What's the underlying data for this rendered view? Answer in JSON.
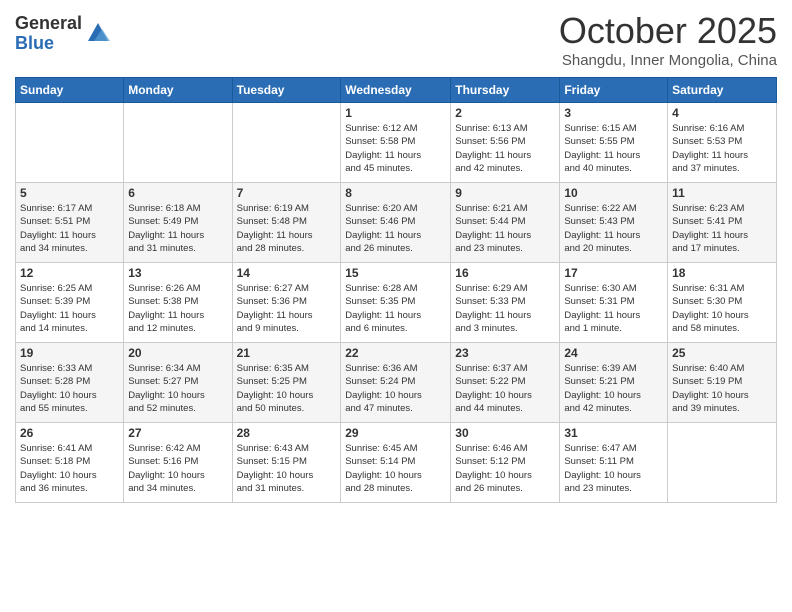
{
  "logo": {
    "general": "General",
    "blue": "Blue"
  },
  "header": {
    "month": "October 2025",
    "location": "Shangdu, Inner Mongolia, China"
  },
  "weekdays": [
    "Sunday",
    "Monday",
    "Tuesday",
    "Wednesday",
    "Thursday",
    "Friday",
    "Saturday"
  ],
  "weeks": [
    [
      {
        "day": "",
        "info": ""
      },
      {
        "day": "",
        "info": ""
      },
      {
        "day": "",
        "info": ""
      },
      {
        "day": "1",
        "info": "Sunrise: 6:12 AM\nSunset: 5:58 PM\nDaylight: 11 hours\nand 45 minutes."
      },
      {
        "day": "2",
        "info": "Sunrise: 6:13 AM\nSunset: 5:56 PM\nDaylight: 11 hours\nand 42 minutes."
      },
      {
        "day": "3",
        "info": "Sunrise: 6:15 AM\nSunset: 5:55 PM\nDaylight: 11 hours\nand 40 minutes."
      },
      {
        "day": "4",
        "info": "Sunrise: 6:16 AM\nSunset: 5:53 PM\nDaylight: 11 hours\nand 37 minutes."
      }
    ],
    [
      {
        "day": "5",
        "info": "Sunrise: 6:17 AM\nSunset: 5:51 PM\nDaylight: 11 hours\nand 34 minutes."
      },
      {
        "day": "6",
        "info": "Sunrise: 6:18 AM\nSunset: 5:49 PM\nDaylight: 11 hours\nand 31 minutes."
      },
      {
        "day": "7",
        "info": "Sunrise: 6:19 AM\nSunset: 5:48 PM\nDaylight: 11 hours\nand 28 minutes."
      },
      {
        "day": "8",
        "info": "Sunrise: 6:20 AM\nSunset: 5:46 PM\nDaylight: 11 hours\nand 26 minutes."
      },
      {
        "day": "9",
        "info": "Sunrise: 6:21 AM\nSunset: 5:44 PM\nDaylight: 11 hours\nand 23 minutes."
      },
      {
        "day": "10",
        "info": "Sunrise: 6:22 AM\nSunset: 5:43 PM\nDaylight: 11 hours\nand 20 minutes."
      },
      {
        "day": "11",
        "info": "Sunrise: 6:23 AM\nSunset: 5:41 PM\nDaylight: 11 hours\nand 17 minutes."
      }
    ],
    [
      {
        "day": "12",
        "info": "Sunrise: 6:25 AM\nSunset: 5:39 PM\nDaylight: 11 hours\nand 14 minutes."
      },
      {
        "day": "13",
        "info": "Sunrise: 6:26 AM\nSunset: 5:38 PM\nDaylight: 11 hours\nand 12 minutes."
      },
      {
        "day": "14",
        "info": "Sunrise: 6:27 AM\nSunset: 5:36 PM\nDaylight: 11 hours\nand 9 minutes."
      },
      {
        "day": "15",
        "info": "Sunrise: 6:28 AM\nSunset: 5:35 PM\nDaylight: 11 hours\nand 6 minutes."
      },
      {
        "day": "16",
        "info": "Sunrise: 6:29 AM\nSunset: 5:33 PM\nDaylight: 11 hours\nand 3 minutes."
      },
      {
        "day": "17",
        "info": "Sunrise: 6:30 AM\nSunset: 5:31 PM\nDaylight: 11 hours\nand 1 minute."
      },
      {
        "day": "18",
        "info": "Sunrise: 6:31 AM\nSunset: 5:30 PM\nDaylight: 10 hours\nand 58 minutes."
      }
    ],
    [
      {
        "day": "19",
        "info": "Sunrise: 6:33 AM\nSunset: 5:28 PM\nDaylight: 10 hours\nand 55 minutes."
      },
      {
        "day": "20",
        "info": "Sunrise: 6:34 AM\nSunset: 5:27 PM\nDaylight: 10 hours\nand 52 minutes."
      },
      {
        "day": "21",
        "info": "Sunrise: 6:35 AM\nSunset: 5:25 PM\nDaylight: 10 hours\nand 50 minutes."
      },
      {
        "day": "22",
        "info": "Sunrise: 6:36 AM\nSunset: 5:24 PM\nDaylight: 10 hours\nand 47 minutes."
      },
      {
        "day": "23",
        "info": "Sunrise: 6:37 AM\nSunset: 5:22 PM\nDaylight: 10 hours\nand 44 minutes."
      },
      {
        "day": "24",
        "info": "Sunrise: 6:39 AM\nSunset: 5:21 PM\nDaylight: 10 hours\nand 42 minutes."
      },
      {
        "day": "25",
        "info": "Sunrise: 6:40 AM\nSunset: 5:19 PM\nDaylight: 10 hours\nand 39 minutes."
      }
    ],
    [
      {
        "day": "26",
        "info": "Sunrise: 6:41 AM\nSunset: 5:18 PM\nDaylight: 10 hours\nand 36 minutes."
      },
      {
        "day": "27",
        "info": "Sunrise: 6:42 AM\nSunset: 5:16 PM\nDaylight: 10 hours\nand 34 minutes."
      },
      {
        "day": "28",
        "info": "Sunrise: 6:43 AM\nSunset: 5:15 PM\nDaylight: 10 hours\nand 31 minutes."
      },
      {
        "day": "29",
        "info": "Sunrise: 6:45 AM\nSunset: 5:14 PM\nDaylight: 10 hours\nand 28 minutes."
      },
      {
        "day": "30",
        "info": "Sunrise: 6:46 AM\nSunset: 5:12 PM\nDaylight: 10 hours\nand 26 minutes."
      },
      {
        "day": "31",
        "info": "Sunrise: 6:47 AM\nSunset: 5:11 PM\nDaylight: 10 hours\nand 23 minutes."
      },
      {
        "day": "",
        "info": ""
      }
    ]
  ]
}
